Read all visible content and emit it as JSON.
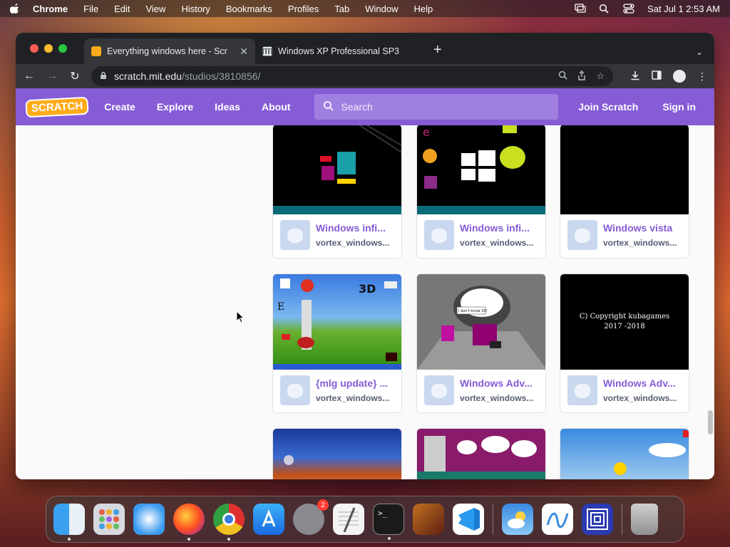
{
  "menubar": {
    "app": "Chrome",
    "items": [
      "File",
      "Edit",
      "View",
      "History",
      "Bookmarks",
      "Profiles",
      "Tab",
      "Window",
      "Help"
    ],
    "clock": "Sat Jul 1  2:53 AM"
  },
  "tabs": [
    {
      "title": "Everything windows here - Scr",
      "active": true
    },
    {
      "title": "Windows XP Professional SP3",
      "active": false
    }
  ],
  "address": {
    "host": "scratch.mit.edu",
    "path": "/studios/3810856/"
  },
  "scratch": {
    "logo": "SCRATCH",
    "nav": [
      "Create",
      "Explore",
      "Ideas",
      "About"
    ],
    "search_placeholder": "Search",
    "join": "Join Scratch",
    "signin": "Sign in"
  },
  "projects": [
    {
      "title": "Windows infi...",
      "author": "vortex_windows..."
    },
    {
      "title": "Windows infi...",
      "author": "vortex_windows..."
    },
    {
      "title": "Windows vista",
      "author": "vortex_windows..."
    },
    {
      "title": "{mlg update} ...",
      "author": "vortex_windows..."
    },
    {
      "title": "Windows Adv...",
      "author": "vortex_windows..."
    },
    {
      "title": "Windows Adv...",
      "author": "vortex_windows..."
    }
  ],
  "thumb_texts": {
    "copyright": "C) Copyright kubagames\n2017 -2018",
    "threed": "3D",
    "dont_know": "I don't know 20!"
  },
  "dock": {
    "apps": [
      "finder-icon",
      "launchpad-icon",
      "safari-icon",
      "firefox-icon",
      "chrome-icon",
      "app-store-icon",
      "system-settings-icon",
      "textedit-icon",
      "terminal-icon",
      "garageband-icon",
      "vscode-icon",
      "weather-icon",
      "freeform-icon",
      "screen-app-icon",
      "trash-icon"
    ],
    "settings_badge": "2"
  },
  "colors": {
    "scratch_purple": "#855cd6",
    "scratch_orange": "#ffab19"
  }
}
